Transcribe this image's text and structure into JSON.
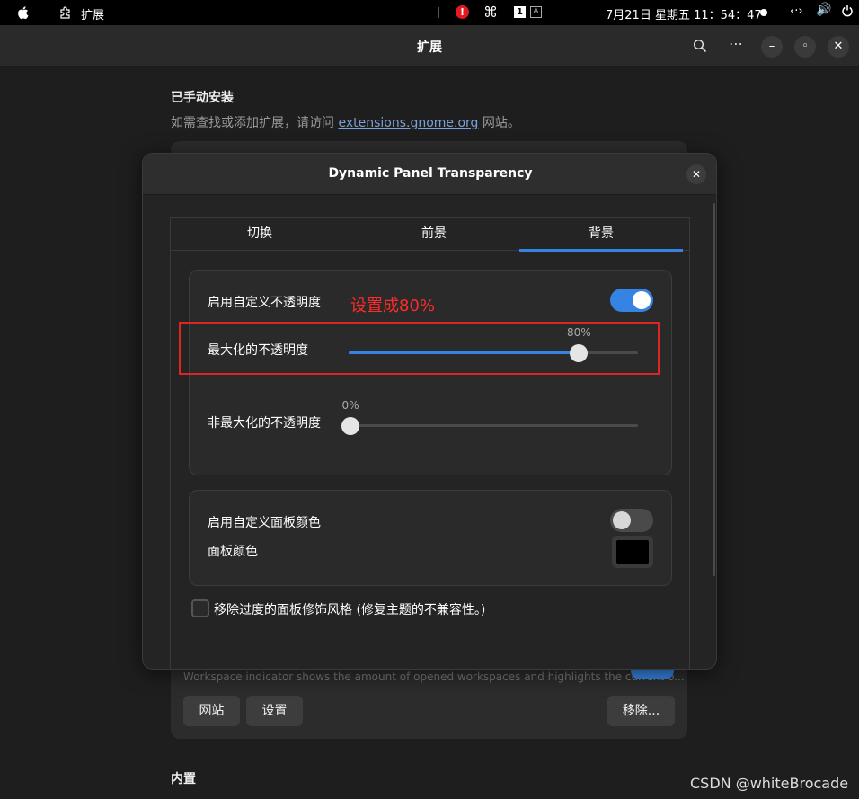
{
  "topbar": {
    "app_name": "扩展",
    "clock": "7月21日 星期五 11：54：47",
    "command_glyph": "⌘",
    "kb_indicator_1": "1",
    "kb_indicator_2": "A",
    "alert_glyph": "!",
    "net_glyph": "‹·›",
    "volume_glyph": "🔊"
  },
  "window": {
    "title": "扩展",
    "more_glyph": "⋯",
    "minimize_glyph": "–",
    "restore_glyph": "◦",
    "close_glyph": "✕"
  },
  "background": {
    "section_title": "已手动安装",
    "subtitle_prefix": "如需查找或添加扩展，请访问 ",
    "subtitle_link": "extensions.gnome.org",
    "subtitle_suffix": " 网站。",
    "extension_description": "Workspace indicator shows the amount of opened workspaces and highlights the current o...",
    "buttons": {
      "website": "网站",
      "settings": "设置",
      "remove": "移除..."
    },
    "builtin_title": "内置"
  },
  "dialog": {
    "title": "Dynamic Panel Transparency",
    "close_glyph": "✕",
    "tabs": [
      {
        "label": "切换",
        "active": false
      },
      {
        "label": "前景",
        "active": false
      },
      {
        "label": "背景",
        "active": true
      }
    ],
    "opacity_group": {
      "enable_custom_opacity_label": "启用自定义不透明度",
      "enable_custom_opacity": true,
      "maximized_opacity_label": "最大化的不透明度",
      "maximized_opacity_value": "80%",
      "maximized_opacity": 0.8,
      "unmaximized_opacity_label": "非最大化的不透明度",
      "unmaximized_opacity_value": "0%",
      "unmaximized_opacity": 0.0
    },
    "color_group": {
      "enable_custom_color_label": "启用自定义面板颜色",
      "enable_custom_color": false,
      "panel_color_label": "面板颜色",
      "panel_color": "#000000"
    },
    "remove_styling_label": "移除过度的面板修饰风格 (修复主题的不兼容性。)",
    "remove_styling_checked": false
  },
  "annotation": {
    "text": "设置成80%",
    "color": "#e02424"
  },
  "watermark": "CSDN @whiteBrocade",
  "colors": {
    "accent": "#3584e4",
    "window_bg": "#1e1e1e"
  }
}
